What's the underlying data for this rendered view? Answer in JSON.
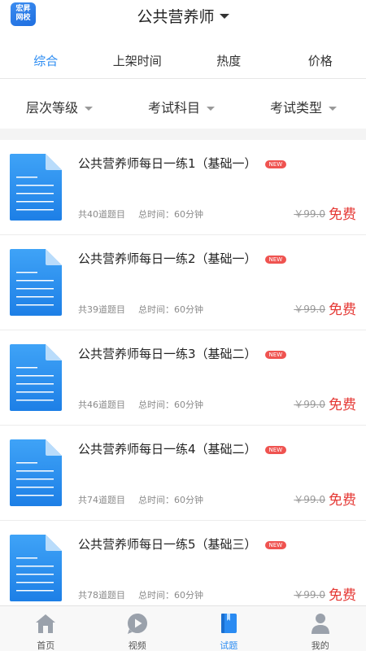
{
  "header": {
    "logo_line1": "宏昇",
    "logo_line2": "网校",
    "title": "公共营养师"
  },
  "sort_tabs": [
    {
      "label": "综合",
      "active": true
    },
    {
      "label": "上架时间",
      "active": false
    },
    {
      "label": "热度",
      "active": false
    },
    {
      "label": "价格",
      "active": false
    }
  ],
  "filters": [
    {
      "label": "层次等级"
    },
    {
      "label": "考试科目"
    },
    {
      "label": "考试类型"
    }
  ],
  "items": [
    {
      "title": "公共营养师每日一练1（基础一）",
      "badge": "NEW",
      "count": "共40道题目",
      "duration": "总时间：60分钟",
      "old_price": "￥99.0",
      "price": "免费"
    },
    {
      "title": "公共营养师每日一练2（基础一）",
      "badge": "NEW",
      "count": "共39道题目",
      "duration": "总时间：60分钟",
      "old_price": "￥99.0",
      "price": "免费"
    },
    {
      "title": "公共营养师每日一练3（基础二）",
      "badge": "NEW",
      "count": "共46道题目",
      "duration": "总时间：60分钟",
      "old_price": "￥99.0",
      "price": "免费"
    },
    {
      "title": "公共营养师每日一练4（基础二）",
      "badge": "NEW",
      "count": "共74道题目",
      "duration": "总时间：60分钟",
      "old_price": "￥99.0",
      "price": "免费"
    },
    {
      "title": "公共营养师每日一练5（基础三）",
      "badge": "NEW",
      "count": "共78道题目",
      "duration": "总时间：60分钟",
      "old_price": "￥99.0",
      "price": "免费"
    }
  ],
  "nav": [
    {
      "label": "首页",
      "icon": "home-icon",
      "active": false
    },
    {
      "label": "视频",
      "icon": "video-icon",
      "active": false
    },
    {
      "label": "试题",
      "icon": "book-icon",
      "active": true
    },
    {
      "label": "我的",
      "icon": "user-icon",
      "active": false
    }
  ],
  "colors": {
    "accent": "#2a8bf2",
    "price_red": "#e53935",
    "badge_red": "#ef5350"
  }
}
